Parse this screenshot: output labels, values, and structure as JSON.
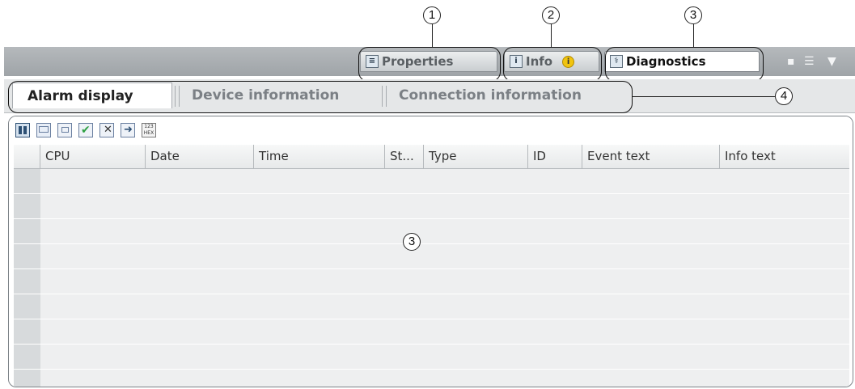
{
  "callouts": [
    "1",
    "2",
    "3",
    "4",
    "3"
  ],
  "top_tabs": [
    {
      "label": "Properties",
      "icon": "properties-icon"
    },
    {
      "label": "Info",
      "icon": "info-icon",
      "badge": "i"
    },
    {
      "label": "Diagnostics",
      "icon": "diagnostics-icon"
    }
  ],
  "sub_tabs": [
    {
      "label": "Alarm display"
    },
    {
      "label": "Device information"
    },
    {
      "label": "Connection information"
    }
  ],
  "toolbar_icons": [
    "toggle-view-icon",
    "message-icon",
    "acknowledge-icon",
    "acknowledge-all-icon",
    "delete-message-icon",
    "export-icon",
    "hex-display-icon"
  ],
  "hex_icon_text": "123 HEX",
  "columns": [
    "CPU",
    "Date",
    "Time",
    "St...",
    "Type",
    "ID",
    "Event text",
    "Info text"
  ],
  "row_count": 9,
  "colors": {
    "accent": "#f1c40f",
    "bar": "#a9adb1"
  }
}
